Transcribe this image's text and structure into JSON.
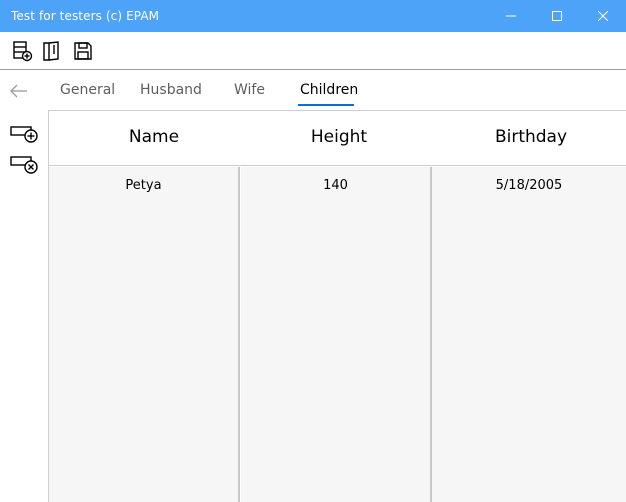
{
  "window": {
    "title": "Test for testers (c) EPAM",
    "controls": [
      "minimize-icon",
      "maximize-icon",
      "close-icon"
    ]
  },
  "toolbar": {
    "buttons": [
      "add-record-icon",
      "open-book-icon",
      "save-icon"
    ]
  },
  "nav": {
    "back_icon": "back-arrow-icon",
    "tabs": [
      {
        "label": "General",
        "active": false
      },
      {
        "label": "Husband",
        "active": false
      },
      {
        "label": "Wife",
        "active": false
      },
      {
        "label": "Children",
        "active": true
      }
    ],
    "accent": "#0a6fd4"
  },
  "side": {
    "buttons": [
      "add-row-icon",
      "remove-row-icon"
    ]
  },
  "grid": {
    "columns": [
      "Name",
      "Height",
      "Birthday"
    ],
    "rows": [
      [
        "Petya",
        "140",
        "5/18/2005"
      ]
    ]
  },
  "colors": {
    "titlebar": "#4da3f7",
    "cell_background": "#f6f6f6"
  }
}
